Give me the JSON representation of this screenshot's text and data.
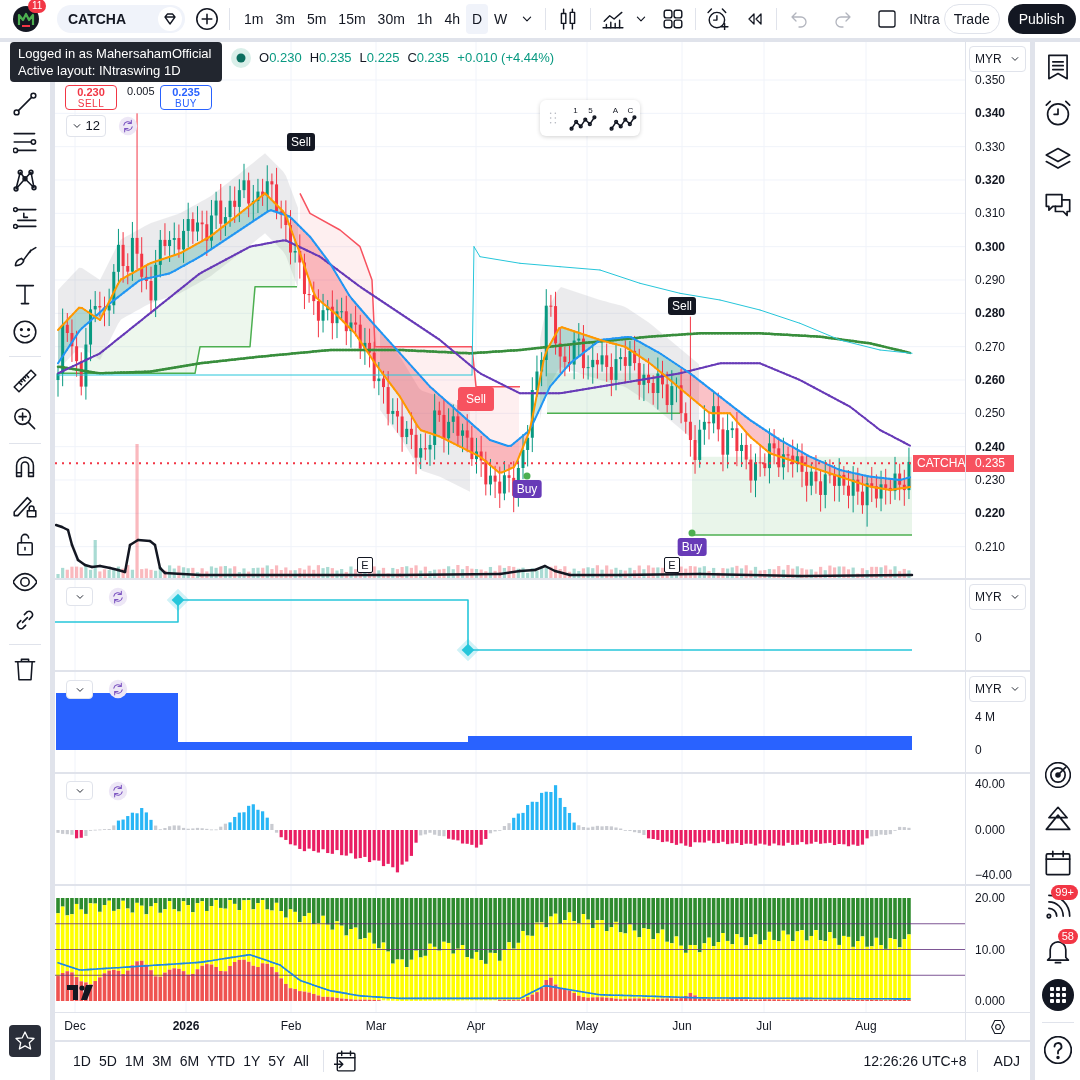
{
  "top_toolbar": {
    "avatar_badge": "11",
    "symbol": "CATCHA",
    "intervals": [
      {
        "label": "1m",
        "selected": false
      },
      {
        "label": "3m",
        "selected": false
      },
      {
        "label": "5m",
        "selected": false
      },
      {
        "label": "15m",
        "selected": false
      },
      {
        "label": "30m",
        "selected": false
      },
      {
        "label": "1h",
        "selected": false
      },
      {
        "label": "4h",
        "selected": false
      },
      {
        "label": "D",
        "selected": true
      },
      {
        "label": "W",
        "selected": false
      }
    ],
    "layout_name": "INtra",
    "trade_button": "Trade",
    "publish_button": "Publish"
  },
  "tooltip": {
    "lines": [
      "Logged in as MahersahamOfficial",
      "Active layout: INtraswing 1D"
    ]
  },
  "legend": {
    "ohlc": [
      {
        "label": "O",
        "value": "0.230"
      },
      {
        "label": "H",
        "value": "0.235"
      },
      {
        "label": "L",
        "value": "0.225"
      },
      {
        "label": "C",
        "value": "0.235"
      }
    ],
    "change": "+0.010 (+4.44%)"
  },
  "order_panel": {
    "sell": {
      "price": "0.230",
      "label": "SELL"
    },
    "spread": "0.005",
    "buy": {
      "price": "0.235",
      "label": "BUY"
    }
  },
  "indicators_toggle": "12",
  "pattern_tools": [
    {
      "marks": [
        "1",
        "5"
      ]
    },
    {
      "marks": [
        "A",
        "C"
      ]
    }
  ],
  "signals": [
    {
      "kind": "sell",
      "label": "Sell",
      "color": "#131722"
    },
    {
      "kind": "sell",
      "label": "Sell",
      "color": "#f7525f"
    },
    {
      "kind": "buy",
      "label": "Buy",
      "color": "#673ab7"
    },
    {
      "kind": "sell",
      "label": "Sell",
      "color": "#131722"
    },
    {
      "kind": "buy",
      "label": "Buy",
      "color": "#673ab7"
    }
  ],
  "events": [
    {
      "label": "E"
    },
    {
      "label": "E"
    }
  ],
  "last_price": {
    "symbol": "CATCHA",
    "price": "0.235"
  },
  "price_axis": {
    "currency": "MYR",
    "ticks": [
      {
        "label": "0.350",
        "major": false
      },
      {
        "label": "0.340",
        "major": true
      },
      {
        "label": "0.330",
        "major": false
      },
      {
        "label": "0.320",
        "major": true
      },
      {
        "label": "0.310",
        "major": false
      },
      {
        "label": "0.300",
        "major": true
      },
      {
        "label": "0.290",
        "major": false
      },
      {
        "label": "0.280",
        "major": true
      },
      {
        "label": "0.270",
        "major": false
      },
      {
        "label": "0.260",
        "major": true
      },
      {
        "label": "0.250",
        "major": false
      },
      {
        "label": "0.240",
        "major": true
      },
      {
        "label": "0.230",
        "major": false
      },
      {
        "label": "0.220",
        "major": true
      },
      {
        "label": "0.210",
        "major": false
      }
    ]
  },
  "panes": [
    {
      "currency": "MYR",
      "ticks": [
        "0"
      ]
    },
    {
      "currency": "MYR",
      "ticks": [
        "4 M",
        "0"
      ]
    },
    {
      "ticks": [
        "40.00",
        "0.000",
        "−40.00"
      ]
    },
    {
      "ticks": [
        "20.00",
        "10.00",
        "0.000"
      ]
    }
  ],
  "time_axis": [
    {
      "label": "Dec",
      "major": false
    },
    {
      "label": "2026",
      "major": true
    },
    {
      "label": "Feb",
      "major": false
    },
    {
      "label": "Mar",
      "major": false
    },
    {
      "label": "Apr",
      "major": false
    },
    {
      "label": "May",
      "major": false
    },
    {
      "label": "Jun",
      "major": false
    },
    {
      "label": "Jul",
      "major": false
    },
    {
      "label": "Aug",
      "major": false
    }
  ],
  "bottom_bar": {
    "ranges": [
      "1D",
      "5D",
      "1M",
      "3M",
      "6M",
      "YTD",
      "1Y",
      "5Y",
      "All"
    ],
    "clock": "12:26:26 UTC+8",
    "adjustment": "ADJ"
  },
  "right_toolbar": {
    "feed_badge": "99+",
    "alerts_badge": "58"
  }
}
